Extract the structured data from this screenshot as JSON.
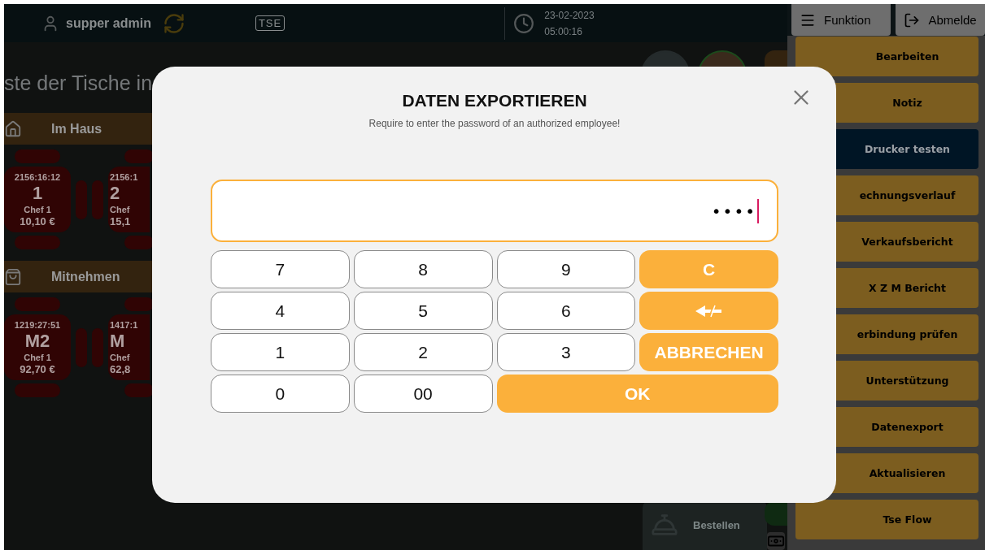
{
  "top_bar": {
    "user": "supper admin",
    "tse_badge": "TSE",
    "date": "23-02-2023",
    "time": "05:00:16"
  },
  "tables_view": {
    "title": "ste der Tische in",
    "sections": [
      {
        "kind": "house",
        "label": "Im Haus",
        "tables": [
          {
            "timer": "2156:16:12",
            "name": "1",
            "waiter": "Chef 1",
            "amount": "10,10 €"
          },
          {
            "timer": "2156:1",
            "name": "2",
            "waiter": "Chef",
            "amount": "15,1"
          }
        ]
      },
      {
        "kind": "takeaway",
        "label": "Mitnehmen",
        "tables": [
          {
            "timer": "1219:27:51",
            "name": "M2",
            "waiter": "Chef 1",
            "amount": "92,70 €"
          },
          {
            "timer": "1417:1",
            "name": "M",
            "waiter": "Chef",
            "amount": "62,8"
          }
        ]
      }
    ]
  },
  "order_button": "Bestellen",
  "function_panel": {
    "header_buttons": [
      {
        "kind": "menu",
        "label": "Funktion"
      },
      {
        "kind": "logout",
        "label": "Abmelde"
      }
    ],
    "items": [
      {
        "label": "Bearbeiten",
        "selected": false
      },
      {
        "label": "Notiz",
        "selected": false
      },
      {
        "label": "Drucker testen",
        "selected": true
      },
      {
        "label": "echnungsverlauf",
        "selected": false
      },
      {
        "label": "Verkaufsbericht",
        "selected": false
      },
      {
        "label": "X Z M Bericht",
        "selected": false
      },
      {
        "label": "erbindung prüfen",
        "selected": false
      },
      {
        "label": "Unterstützung",
        "selected": false
      },
      {
        "label": "Datenexport",
        "selected": false
      },
      {
        "label": "Aktualisieren",
        "selected": false
      },
      {
        "label": "Tse Flow",
        "selected": false
      }
    ]
  },
  "dialog": {
    "title": "DATEN EXPORTIEREN",
    "subtitle": "Require to enter the password of an authorized employee!",
    "password": {
      "value": "••••"
    },
    "keys": [
      {
        "kind": "digit",
        "label": "7"
      },
      {
        "kind": "digit",
        "label": "8"
      },
      {
        "kind": "digit",
        "label": "9"
      },
      {
        "kind": "action",
        "label": "C"
      },
      {
        "kind": "digit",
        "label": "4"
      },
      {
        "kind": "digit",
        "label": "5"
      },
      {
        "kind": "digit",
        "label": "6"
      },
      {
        "kind": "backspace"
      },
      {
        "kind": "digit",
        "label": "1"
      },
      {
        "kind": "digit",
        "label": "2"
      },
      {
        "kind": "digit",
        "label": "3"
      },
      {
        "kind": "action",
        "label": "ABBRECHEN"
      },
      {
        "kind": "digit",
        "label": "0"
      },
      {
        "kind": "digit",
        "label": "00"
      },
      {
        "kind": "confirm",
        "label": "OK"
      }
    ]
  }
}
